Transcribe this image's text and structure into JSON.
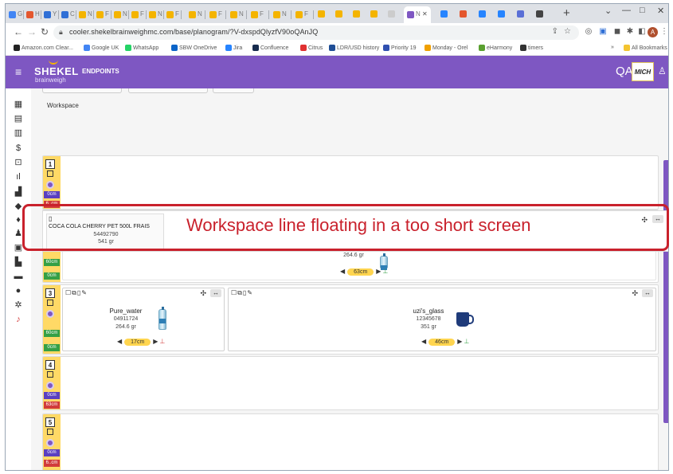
{
  "browser": {
    "tabs_prefix": [
      "G",
      "H",
      "Y",
      "C",
      "N",
      "F",
      "N",
      "F",
      "N",
      "F",
      "N",
      "F",
      "N",
      "F",
      "N",
      "F"
    ],
    "active_tab_label": "N",
    "new_tab": "+",
    "window_controls": {
      "minimize": "⌄",
      "restore": "—",
      "maximize": "□",
      "close": "✕"
    },
    "url": "cooler.shekelbrainweighmc.com/base/planogram/?V-dxspdQlyzfV90oQAnJQ",
    "bookmarks": [
      {
        "label": "Amazon.com Clear...",
        "color": "#222222"
      },
      {
        "label": "Google UK",
        "color": "#4285f4"
      },
      {
        "label": "WhatsApp",
        "color": "#25d366"
      },
      {
        "label": "SBW OneDrive",
        "color": "#0a64c8"
      },
      {
        "label": "Jira",
        "color": "#2684ff"
      },
      {
        "label": "Confluence",
        "color": "#172b4d"
      },
      {
        "label": "Citrus",
        "color": "#e03030"
      },
      {
        "label": "LDR/USD history",
        "color": "#1f4e96"
      },
      {
        "label": "Priority 19",
        "color": "#3050b0"
      },
      {
        "label": "Monday - Orel",
        "color": "#f0a000"
      },
      {
        "label": "eHarmony",
        "color": "#5aa030"
      },
      {
        "label": "timers",
        "color": "#333333"
      }
    ],
    "bookmarks_more": "»",
    "all_bookmarks": "All Bookmarks"
  },
  "app": {
    "brand": "SHEKEL",
    "brand_sub": "brainweigh",
    "section": "ENDPOINTS",
    "user_initials": "QA",
    "badge": "MICH",
    "accent": "#7e57c2"
  },
  "workspace": {
    "label": "Workspace",
    "annotation": "Workspace line floating in a too short screen",
    "floating_item": {
      "name": "COCA COLA CHERRY PET 500L FRAIS",
      "code": "54492790",
      "weight": "541 gr"
    },
    "floating_width_label": "63cm",
    "floating_weight_partial": "264.6 gr"
  },
  "shelves": [
    {
      "number": "1",
      "cap_top": "0cm",
      "cap_bottom": "6..cm"
    },
    {
      "number": "2",
      "cap_top": "60cm",
      "cap_bottom": "0cm"
    },
    {
      "number": "3",
      "cap_top": "60cm",
      "cap_bottom": "0cm",
      "cells": [
        {
          "name": "Pure_water",
          "code": "04911724",
          "weight": "264.6 gr",
          "width": "17cm"
        },
        {
          "name": "uzi's_glass",
          "code": "12345678",
          "weight": "351 gr",
          "width": "46cm"
        }
      ]
    },
    {
      "number": "4",
      "cap_top": "0cm",
      "cap_bottom": "63cm"
    },
    {
      "number": "5",
      "cap_top": "0cm",
      "cap_bottom": "6..cm"
    }
  ]
}
